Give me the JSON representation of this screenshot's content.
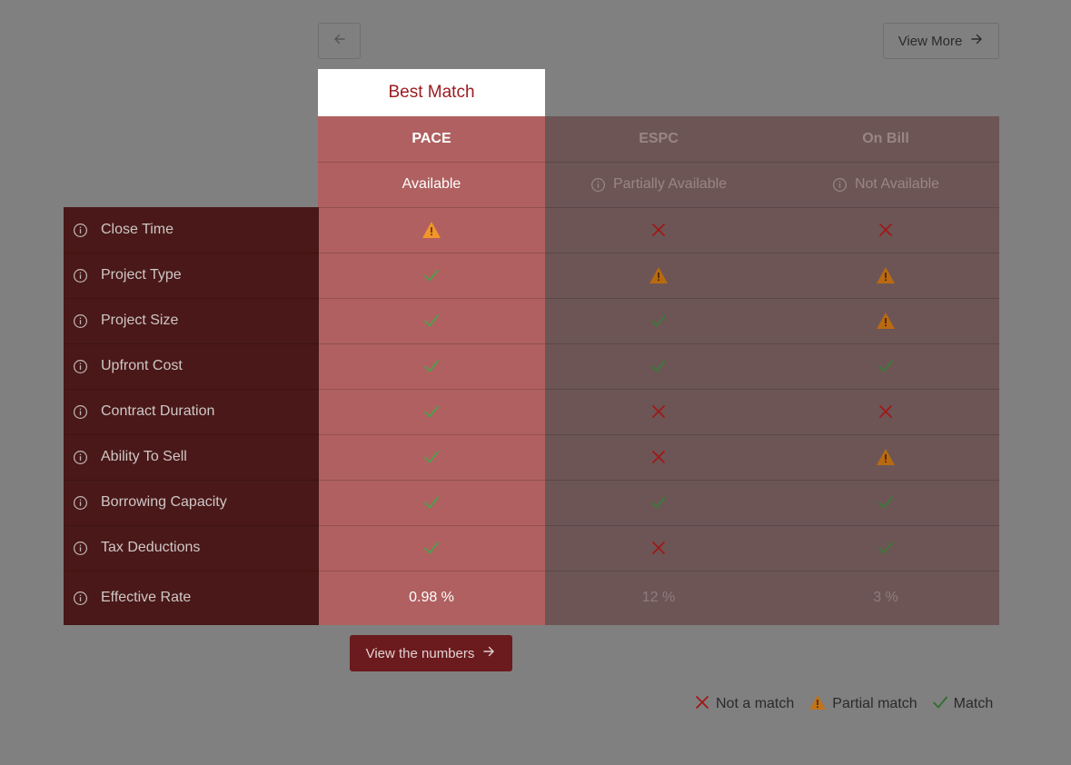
{
  "nav": {
    "view_more_label": "View More"
  },
  "banner": {
    "best_match": "Best Match"
  },
  "columns": [
    {
      "name": "PACE",
      "availability": "Available",
      "rate": "0.98 %"
    },
    {
      "name": "ESPC",
      "availability": "Partially Available",
      "rate": "12 %"
    },
    {
      "name": "On Bill",
      "availability": "Not Available",
      "rate": "3 %"
    }
  ],
  "rows": [
    {
      "label": "Close Time",
      "values": [
        "partial",
        "no",
        "no"
      ]
    },
    {
      "label": "Project Type",
      "values": [
        "match",
        "partial",
        "partial"
      ]
    },
    {
      "label": "Project Size",
      "values": [
        "match",
        "match",
        "partial"
      ]
    },
    {
      "label": "Upfront Cost",
      "values": [
        "match",
        "match",
        "match"
      ]
    },
    {
      "label": "Contract Duration",
      "values": [
        "match",
        "no",
        "no"
      ]
    },
    {
      "label": "Ability To Sell",
      "values": [
        "match",
        "no",
        "partial"
      ]
    },
    {
      "label": "Borrowing Capacity",
      "values": [
        "match",
        "match",
        "match"
      ]
    },
    {
      "label": "Tax Deductions",
      "values": [
        "match",
        "no",
        "match"
      ]
    }
  ],
  "rate_row_label": "Effective Rate",
  "actions": {
    "view_numbers_label": "View the numbers"
  },
  "legend": {
    "not_match": "Not a match",
    "partial_match": "Partial match",
    "match": "Match"
  },
  "colors": {
    "pace_column": "#b06060",
    "other_columns": "#6d5555",
    "label_panel": "#4a1818",
    "match_green": "#3d8a3d",
    "not_match_red": "#a01818",
    "partial_orange": "#e08a1e",
    "brand_red": "#9b1c22"
  }
}
